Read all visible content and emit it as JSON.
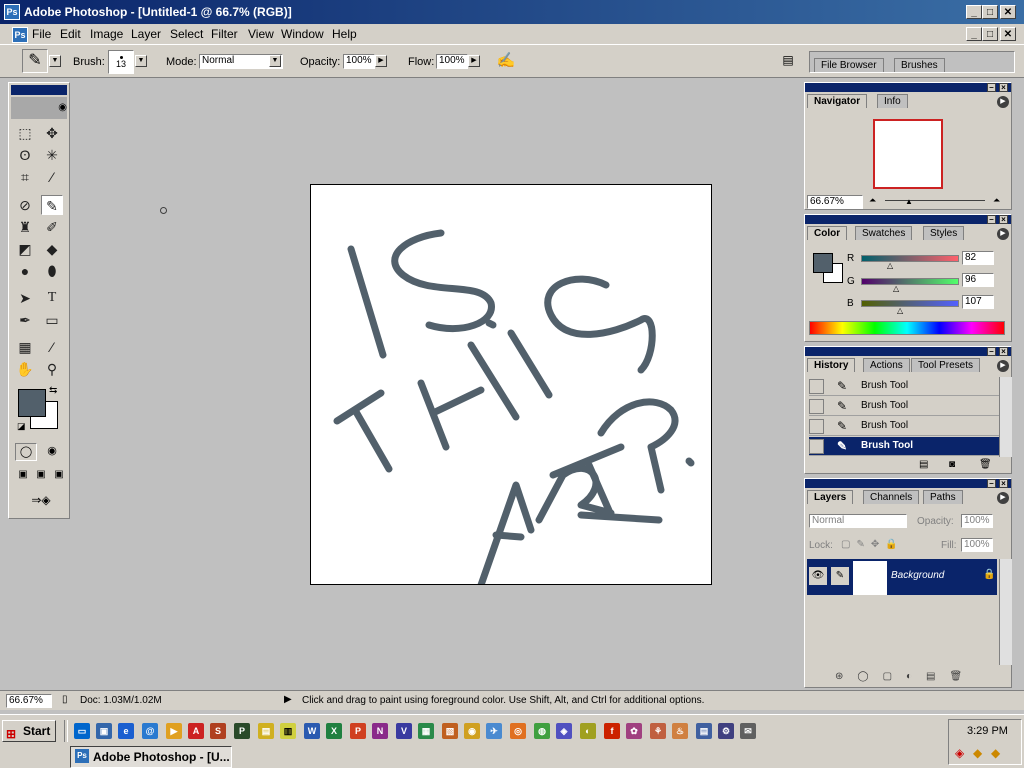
{
  "window": {
    "title": "Adobe Photoshop - [Untitled-1 @ 66.7% (RGB)]",
    "minimize": "_",
    "maximize": "□",
    "close": "✕"
  },
  "menu": [
    "File",
    "Edit",
    "Image",
    "Layer",
    "Select",
    "Filter",
    "View",
    "Window",
    "Help"
  ],
  "options": {
    "brush_label": "Brush:",
    "brush_size": "13",
    "mode_label": "Mode:",
    "mode_value": "Normal",
    "opacity_label": "Opacity:",
    "opacity_value": "100%",
    "flow_label": "Flow:",
    "flow_value": "100%"
  },
  "palette_well": {
    "tabs": [
      "File Browser",
      "Brushes"
    ]
  },
  "navigator": {
    "tabs": [
      "Navigator",
      "Info"
    ],
    "zoom": "66.67%"
  },
  "color": {
    "tabs": [
      "Color",
      "Swatches",
      "Styles"
    ],
    "channels": [
      {
        "label": "R",
        "value": "82"
      },
      {
        "label": "G",
        "value": "96"
      },
      {
        "label": "B",
        "value": "107"
      }
    ],
    "foreground": "#52606b",
    "background": "#ffffff"
  },
  "history": {
    "tabs": [
      "History",
      "Actions",
      "Tool Presets"
    ],
    "items": [
      "Brush Tool",
      "Brush Tool",
      "Brush Tool",
      "Brush Tool"
    ]
  },
  "layers": {
    "tabs": [
      "Layers",
      "Channels",
      "Paths"
    ],
    "blend_mode": "Normal",
    "opacity_label": "Opacity:",
    "opacity_value": "100%",
    "lock_label": "Lock:",
    "fill_label": "Fill:",
    "fill_value": "100%",
    "layer_name": "Background"
  },
  "status": {
    "zoom": "66.67%",
    "doc": "Doc: 1.03M/1.02M",
    "hint": "Click and drag to paint using foreground color.  Use Shift, Alt, and Ctrl for additional options."
  },
  "taskbar": {
    "start": "Start",
    "task": "Adobe Photoshop - [U...",
    "clock": "3:29 PM"
  },
  "stroke_color": "#52606b"
}
